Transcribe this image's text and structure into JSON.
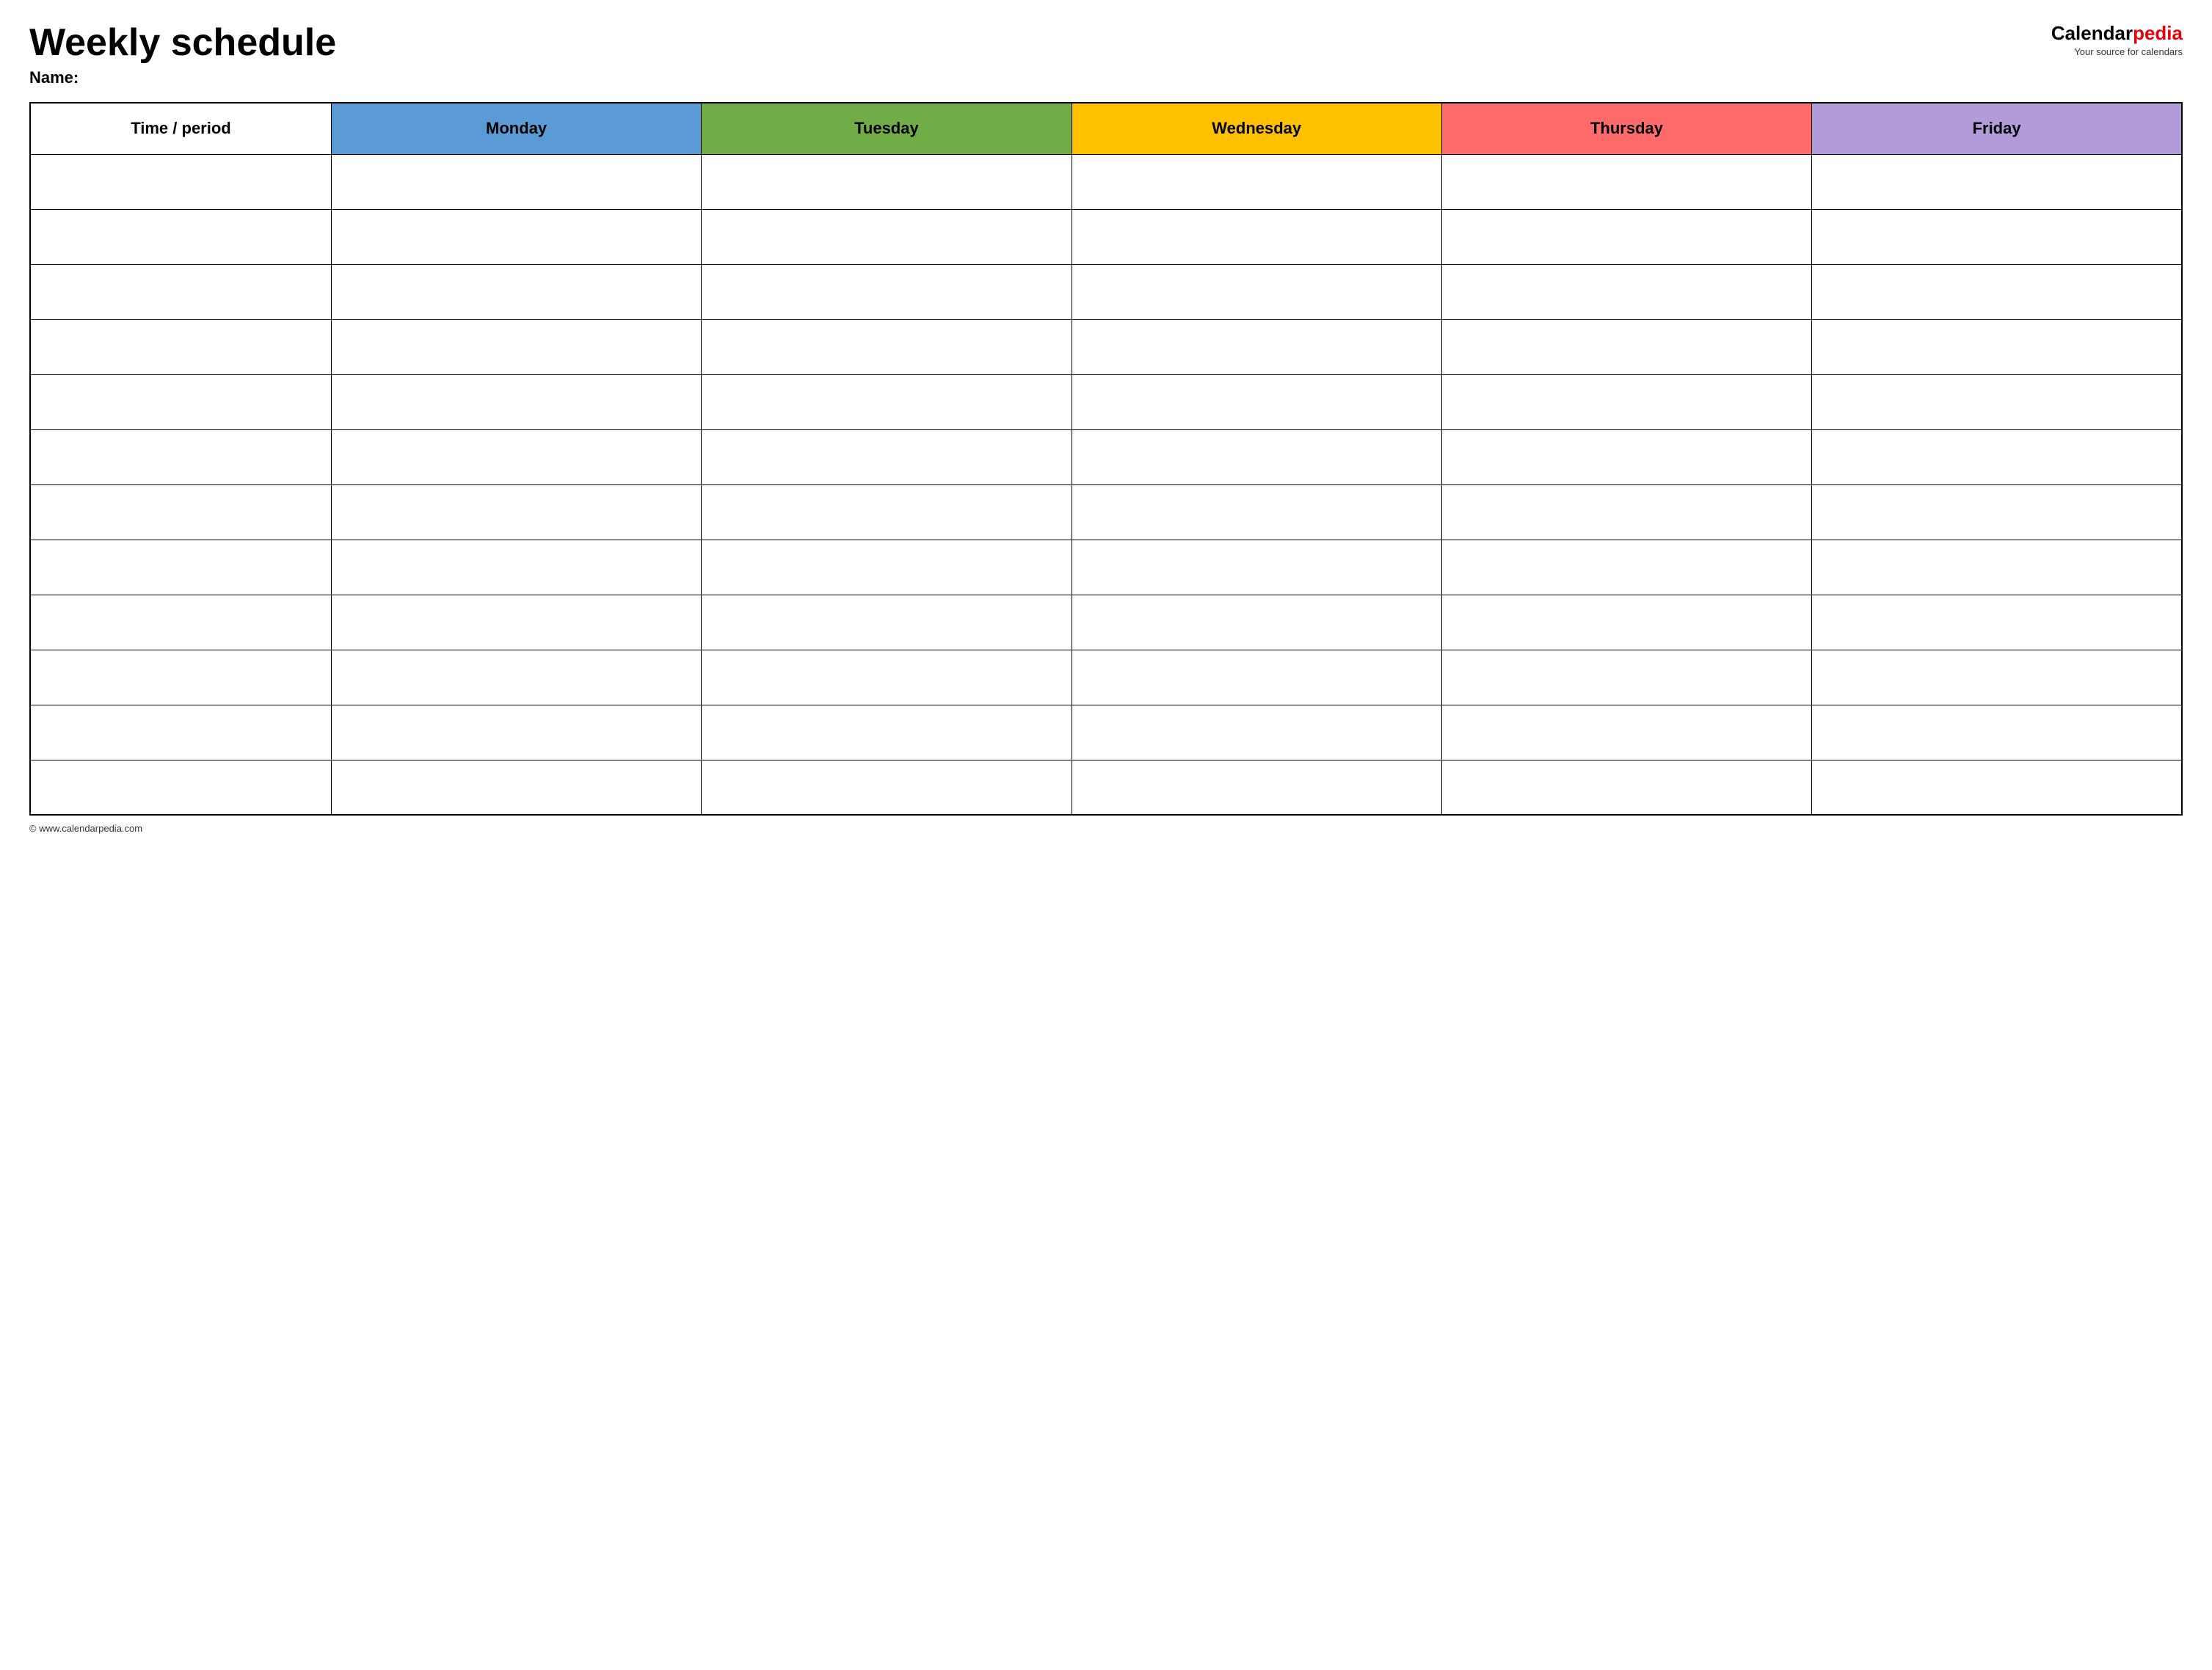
{
  "header": {
    "title": "Weekly schedule",
    "name_label": "Name:",
    "logo": {
      "brand_calendar": "Calendar",
      "brand_pedia": "pedia",
      "tagline": "Your source for calendars"
    }
  },
  "table": {
    "columns": [
      {
        "id": "time",
        "label": "Time / period",
        "color": "#ffffff"
      },
      {
        "id": "monday",
        "label": "Monday",
        "color": "#5b9bd5"
      },
      {
        "id": "tuesday",
        "label": "Tuesday",
        "color": "#70ad47"
      },
      {
        "id": "wednesday",
        "label": "Wednesday",
        "color": "#ffc000"
      },
      {
        "id": "thursday",
        "label": "Thursday",
        "color": "#ff6b6b"
      },
      {
        "id": "friday",
        "label": "Friday",
        "color": "#b19cd9"
      }
    ],
    "row_count": 12
  },
  "footer": {
    "copyright": "© www.calendarpedia.com"
  }
}
